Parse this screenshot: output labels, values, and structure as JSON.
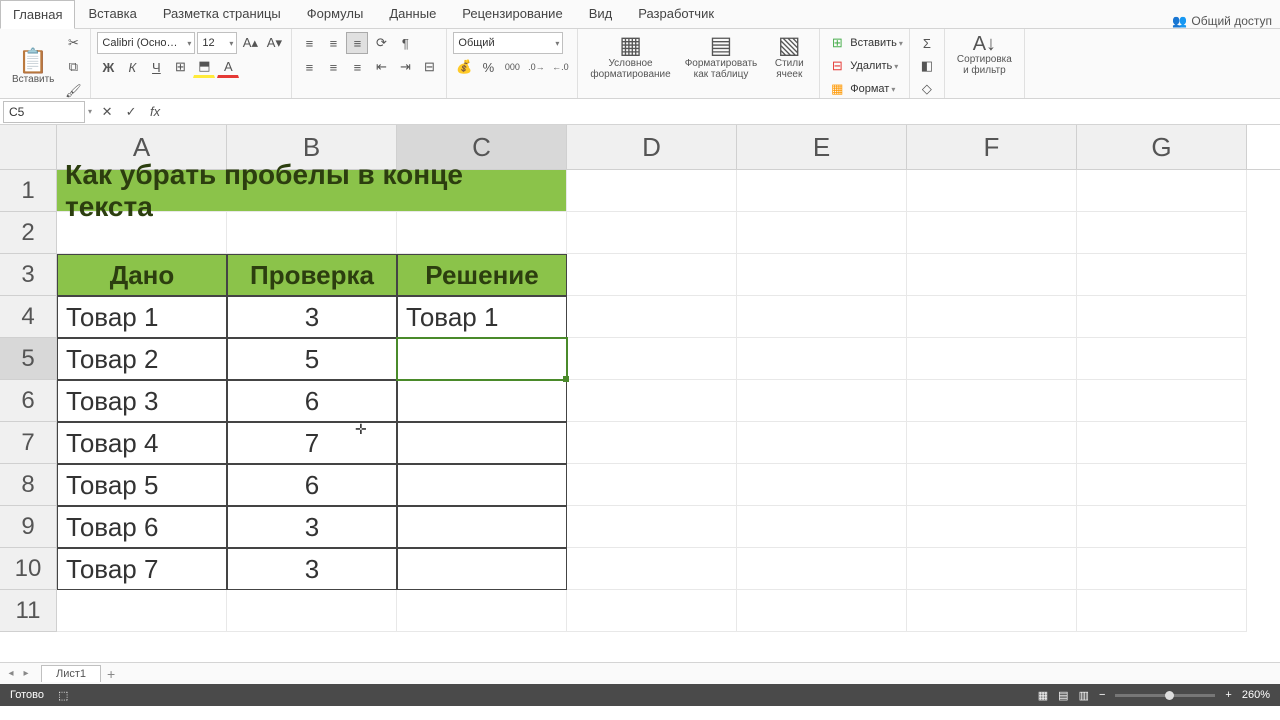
{
  "tabs": {
    "main": "Главная",
    "insert": "Вставка",
    "layout": "Разметка страницы",
    "formulas": "Формулы",
    "data": "Данные",
    "review": "Рецензирование",
    "view": "Вид",
    "developer": "Разработчик"
  },
  "share": "Общий доступ",
  "ribbon": {
    "paste": "Вставить",
    "font_name": "Calibri (Осно…",
    "font_size": "12",
    "number_format": "Общий",
    "cond_fmt": "Условное\nформатирование",
    "fmt_table": "Форматировать\nкак таблицу",
    "cell_styles": "Стили\nячеек",
    "insert": "Вставить",
    "delete": "Удалить",
    "format": "Формат",
    "sort": "Сортировка\nи фильтр"
  },
  "name_box": "C5",
  "formula": "",
  "cols": [
    "A",
    "B",
    "C",
    "D",
    "E",
    "F",
    "G"
  ],
  "rows": [
    "1",
    "2",
    "3",
    "4",
    "5",
    "6",
    "7",
    "8",
    "9",
    "10",
    "11"
  ],
  "title": "Как убрать пробелы в конце текста",
  "headers": {
    "a": "Дано",
    "b": "Проверка",
    "c": "Решение"
  },
  "data": [
    {
      "a": "Товар 1",
      "b": "3",
      "c": "Товар 1"
    },
    {
      "a": "Товар 2",
      "b": "5",
      "c": ""
    },
    {
      "a": "Товар 3",
      "b": "6",
      "c": ""
    },
    {
      "a": "Товар 4",
      "b": "7",
      "c": ""
    },
    {
      "a": "Товар 5",
      "b": "6",
      "c": ""
    },
    {
      "a": "Товар 6",
      "b": "3",
      "c": ""
    },
    {
      "a": "Товар 7",
      "b": "3",
      "c": ""
    }
  ],
  "sheet": "Лист1",
  "status": "Готово",
  "zoom": "260%"
}
